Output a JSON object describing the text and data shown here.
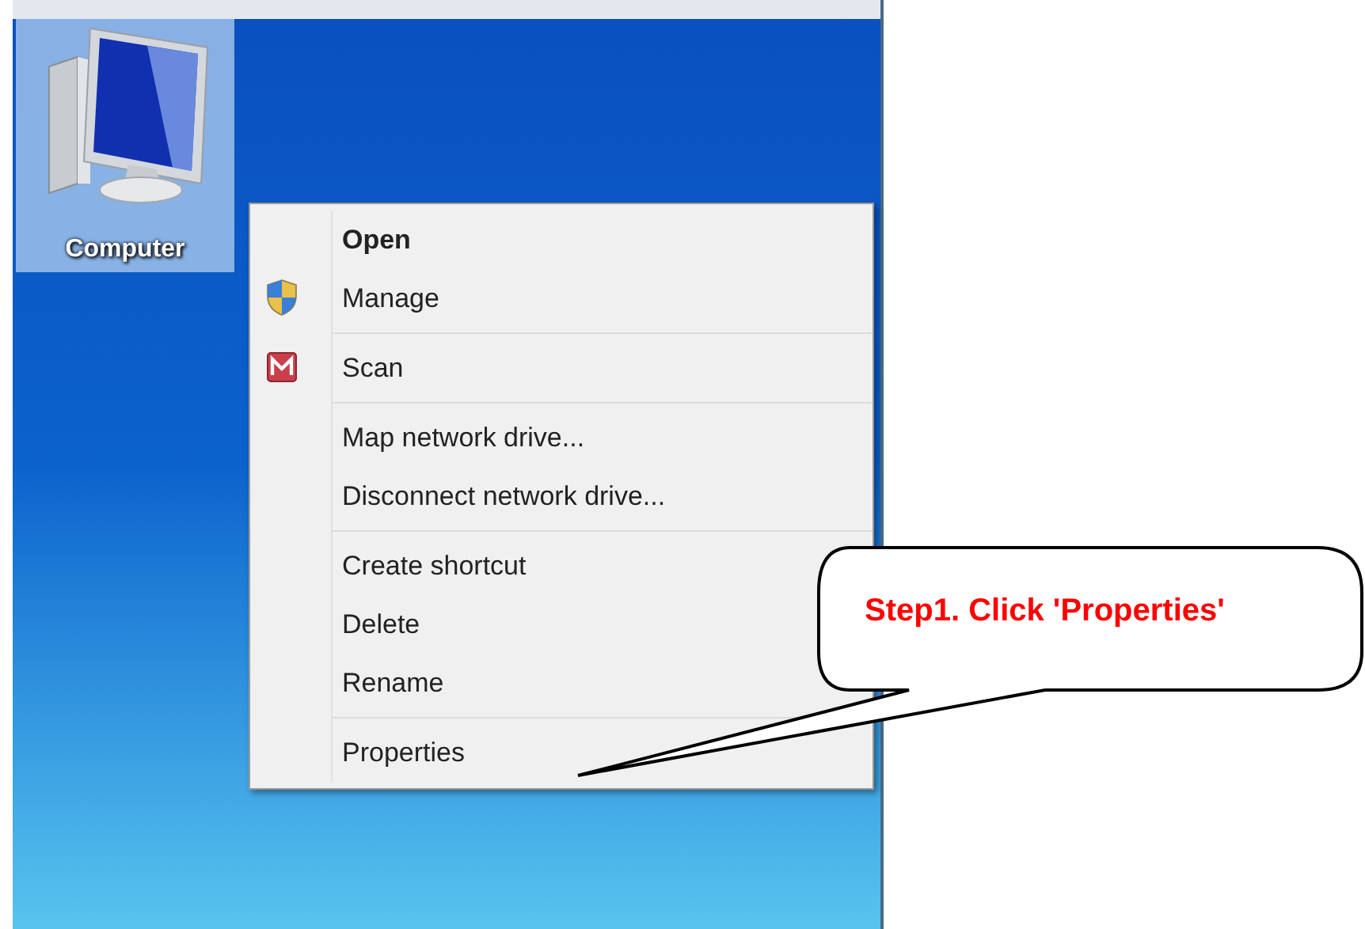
{
  "desktop_icon": {
    "label": "Computer",
    "selected": true
  },
  "context_menu": {
    "groups": [
      [
        {
          "label": "Open",
          "default": true
        },
        {
          "label": "Manage",
          "default": false
        }
      ],
      [
        {
          "label": "Scan",
          "default": false
        }
      ],
      [
        {
          "label": "Map network drive...",
          "default": false
        },
        {
          "label": "Disconnect network drive...",
          "default": false
        }
      ],
      [
        {
          "label": "Create shortcut",
          "default": false
        },
        {
          "label": "Delete",
          "default": false
        },
        {
          "label": "Rename",
          "default": false
        }
      ],
      [
        {
          "label": "Properties",
          "default": false
        }
      ]
    ]
  },
  "callout": {
    "text": "Step1. Click 'Properties'"
  }
}
